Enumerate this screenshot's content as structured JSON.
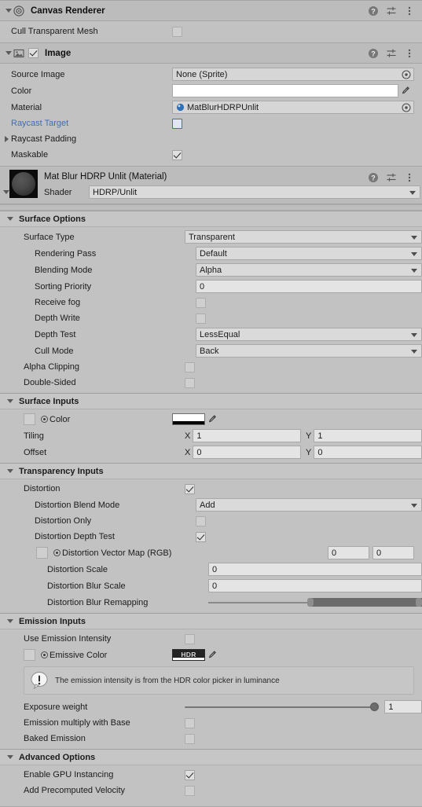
{
  "canvas_renderer": {
    "title": "Canvas Renderer",
    "icon": "canvas-renderer-icon",
    "help_icon": "help-icon",
    "preset_icon": "preset-icon",
    "menu_icon": "kebab-menu-icon",
    "rows": [
      {
        "label": "Cull Transparent Mesh",
        "type": "checkbox",
        "value": false
      }
    ]
  },
  "image_component": {
    "title": "Image",
    "enabled": true,
    "icon": "image-icon",
    "rows": {
      "source_image": {
        "label": "Source Image",
        "value": "None (Sprite)"
      },
      "color": {
        "label": "Color",
        "swatch": "#FFFFFF",
        "alpha_bar": "#000000"
      },
      "material": {
        "label": "Material",
        "value": "MatBlurHDRPUnlit"
      },
      "raycast_target": {
        "label": "Raycast Target",
        "value": false,
        "highlight": true
      },
      "raycast_padding": {
        "label": "Raycast Padding",
        "expanded": false
      },
      "maskable": {
        "label": "Maskable",
        "value": true
      }
    }
  },
  "material": {
    "title": "Mat Blur HDRP Unlit (Material)",
    "shader_label": "Shader",
    "shader_value": "HDRP/Unlit"
  },
  "surface_options": {
    "header": "Surface Options",
    "rows": [
      {
        "label": "Surface Type",
        "type": "dropdown",
        "value": "Transparent",
        "indent": 1
      },
      {
        "label": "Rendering Pass",
        "type": "dropdown",
        "value": "Default",
        "indent": 2
      },
      {
        "label": "Blending Mode",
        "type": "dropdown",
        "value": "Alpha",
        "indent": 2
      },
      {
        "label": "Sorting Priority",
        "type": "number",
        "value": "0",
        "indent": 2
      },
      {
        "label": "Receive fog",
        "type": "checkbox",
        "value": false,
        "indent": 2
      },
      {
        "label": "Depth Write",
        "type": "checkbox",
        "value": false,
        "indent": 2
      },
      {
        "label": "Depth Test",
        "type": "dropdown",
        "value": "LessEqual",
        "indent": 2
      },
      {
        "label": "Cull Mode",
        "type": "dropdown",
        "value": "Back",
        "indent": 2
      },
      {
        "label": "Alpha Clipping",
        "type": "checkbox",
        "value": false,
        "indent": 1
      },
      {
        "label": "Double-Sided",
        "type": "checkbox",
        "value": false,
        "indent": 1
      }
    ]
  },
  "surface_inputs": {
    "header": "Surface Inputs",
    "color": {
      "label": "Color",
      "swatch": "#FFFFFF",
      "alpha_bar": "#000000"
    },
    "tiling": {
      "label": "Tiling",
      "x_label": "X",
      "x": "1",
      "y_label": "Y",
      "y": "1"
    },
    "offset": {
      "label": "Offset",
      "x_label": "X",
      "x": "0",
      "y_label": "Y",
      "y": "0"
    }
  },
  "transparency_inputs": {
    "header": "Transparency Inputs",
    "distortion": {
      "label": "Distortion",
      "value": true
    },
    "distortion_blend_mode": {
      "label": "Distortion Blend Mode",
      "value": "Add"
    },
    "distortion_only": {
      "label": "Distortion Only",
      "value": false
    },
    "distortion_depth_test": {
      "label": "Distortion Depth Test",
      "value": true
    },
    "distortion_vector_map": {
      "label": "Distortion Vector Map (RGB)",
      "n1": "0",
      "n2": "0"
    },
    "distortion_scale": {
      "label": "Distortion Scale",
      "value": "0"
    },
    "distortion_blur_scale": {
      "label": "Distortion Blur Scale",
      "value": "0"
    },
    "distortion_blur_remapping": {
      "label": "Distortion Blur Remapping",
      "min_pct": 48,
      "max_pct": 100
    }
  },
  "emission_inputs": {
    "header": "Emission Inputs",
    "use_emission_intensity": {
      "label": "Use Emission Intensity",
      "value": false
    },
    "emissive_color": {
      "label": "Emissive Color",
      "swatch_label": "HDR",
      "swatch": "#232323"
    },
    "info": {
      "text": "The emission intensity is from the HDR color picker in luminance",
      "icon": "warning-bubble-icon"
    },
    "exposure_weight": {
      "label": "Exposure weight",
      "value": "1",
      "pct": 96
    },
    "emission_multiply_with_base": {
      "label": "Emission multiply with Base",
      "value": false
    },
    "baked_emission": {
      "label": "Baked Emission",
      "value": false
    }
  },
  "advanced_options": {
    "header": "Advanced Options",
    "rows": [
      {
        "label": "Enable GPU Instancing",
        "value": true
      },
      {
        "label": "Add Precomputed Velocity",
        "value": false
      }
    ]
  },
  "colors": {
    "panel_bg": "#c2c2c2",
    "header_bg": "#bcbcbc",
    "section_bg": "#c6c6c6",
    "highlight_blue": "#3e6eb4"
  }
}
